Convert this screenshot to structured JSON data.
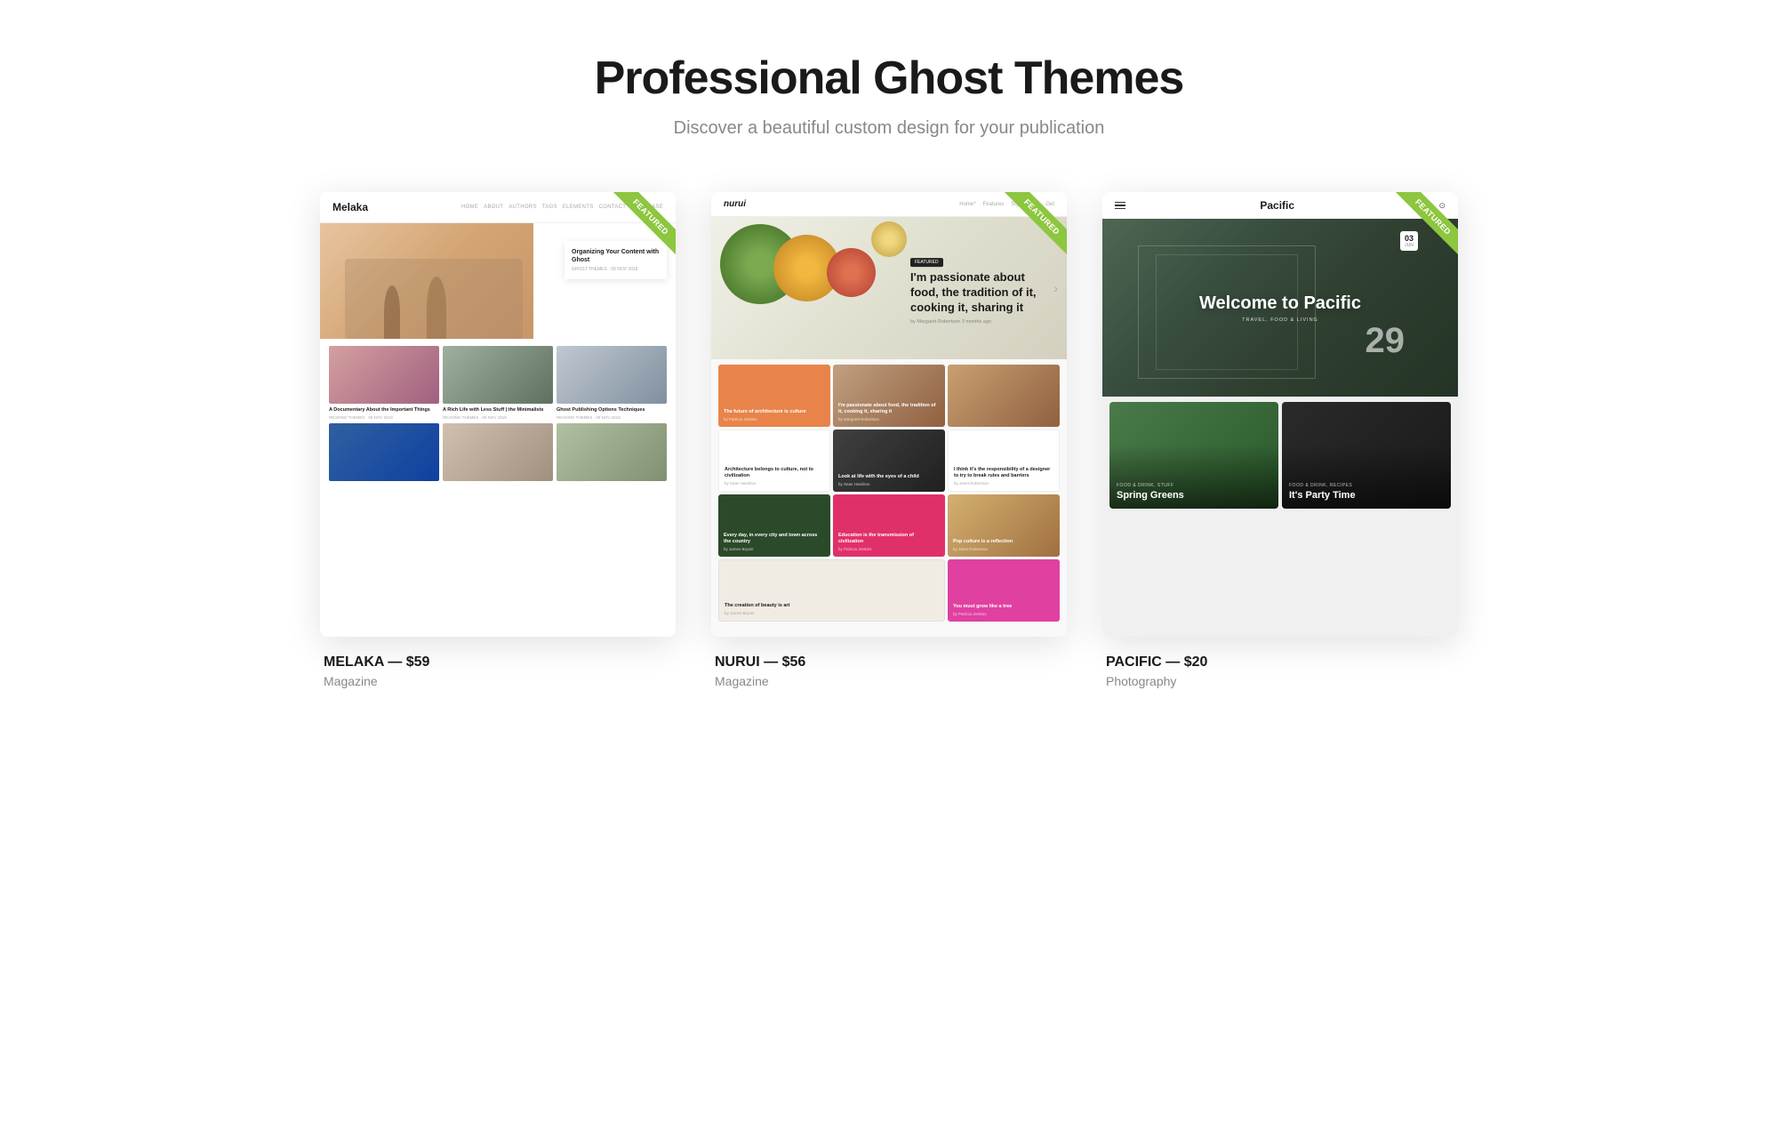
{
  "header": {
    "title": "Professional Ghost Themes",
    "subtitle": "Discover a beautiful custom design for your publication"
  },
  "themes": [
    {
      "id": "melaka",
      "name": "MELAKA",
      "price": "$59",
      "category": "Magazine",
      "featured": true,
      "ribbon_label": "Featured",
      "preview": {
        "logo": "Melaka",
        "hero_card_title": "Organizing Your Content with Ghost",
        "hero_card_meta": "GHOST THEMES · 09 NOV 2018",
        "articles": [
          {
            "title": "A Documentary About the Important Things",
            "meta": "READING THEMES · 09 NOV 2018"
          },
          {
            "title": "A Rich Life with Less Stuff | the Minimalists",
            "meta": "READING THEMES · 09 NOV 2018"
          },
          {
            "title": "Ghost Publishing Options Techniques",
            "meta": "READING THEMES · 09 NOV 2018"
          }
        ]
      }
    },
    {
      "id": "nurui",
      "name": "NURUI",
      "price": "$56",
      "category": "Magazine",
      "featured": true,
      "ribbon_label": "Featured",
      "preview": {
        "logo": "nurui",
        "hero_badge": "FEATURED",
        "hero_title": "I'm passionate about food, the tradition of it, cooking it, sharing it",
        "hero_author": "by Margaret Robertson 3 months ago",
        "cells": [
          {
            "text": "The future of architecture is culture",
            "author": "by Patricia Jenkins",
            "style": "orange"
          },
          {
            "text": "I'm passionate about food, the tradition of it, cooking it, sharing it",
            "author": "by Margaret Robertson",
            "style": "food"
          },
          {
            "text": "",
            "style": "food2"
          },
          {
            "text": "Architecture belongs to culture, not to civilization",
            "author": "by Sean Hamilton",
            "style": "white"
          },
          {
            "text": "Look at life with the eyes of a child",
            "author": "by Sean Hamilton",
            "style": "dark"
          },
          {
            "text": "I think it's the responsibility of a designer to try to break rules and barriers",
            "author": "by Janet Robertson",
            "style": "white"
          },
          {
            "text": "Every day, in every city and town across the country",
            "author": "by James Bryant",
            "style": "green"
          },
          {
            "text": "Education is the transmission of civilization",
            "author": "by Patricia Jenkins",
            "style": "magenta"
          },
          {
            "text": "Pop culture is a reflection",
            "author": "by Janet Robertson",
            "style": "food"
          },
          {
            "text": "The creation of beauty is art",
            "author": "by James Bryant",
            "style": "cream"
          },
          {
            "text": "You must grow like a tree",
            "author": "by Patricia Jenkins",
            "style": "pink"
          }
        ]
      }
    },
    {
      "id": "pacific",
      "name": "PACIFIC",
      "price": "$20",
      "category": "Photography",
      "featured": true,
      "ribbon_label": "Featured",
      "preview": {
        "logo": "Pacific",
        "hero_title": "Welcome to Pacific",
        "hero_category": "TRAVEL, FOOD & LIVING",
        "hero_date_num": "03",
        "hero_date_month": "Jun",
        "hero_number": "29",
        "articles": [
          {
            "title": "Spring Greens",
            "category": "FOOD & DRINK, STUFF"
          },
          {
            "title": "It's Party Time",
            "category": "FOOD & DRINK, RECIPES"
          }
        ]
      }
    }
  ]
}
